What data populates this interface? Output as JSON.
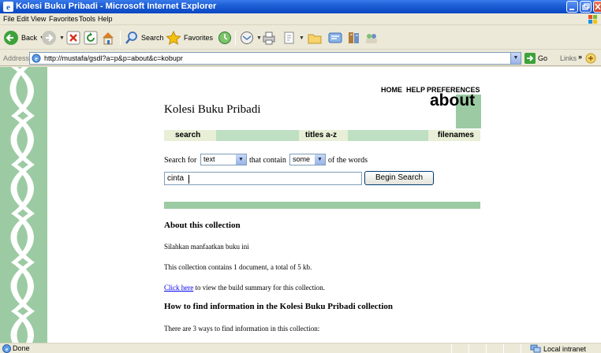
{
  "window": {
    "title": "Kolesi Buku Pribadi - Microsoft Internet Explorer"
  },
  "menu": [
    "File",
    "Edit",
    "View",
    "Favorites",
    "Tools",
    "Help"
  ],
  "toolbar": {
    "back": "Back",
    "search": "Search",
    "favorites": "Favorites"
  },
  "address": {
    "label": "Address",
    "url": "http://mustafa/gsdl?a=p&p=about&c=kobupr",
    "go": "Go",
    "links": "Links",
    "chevron": "»"
  },
  "page": {
    "nav_links": [
      "HOME",
      "HELP",
      "PREFERENCES"
    ],
    "collection_title": "Kolesi Buku Pribadi",
    "page_name": "about",
    "nav_bar": [
      "search",
      "titles a-z",
      "filenames"
    ],
    "search": {
      "search_for": "Search for",
      "field_value": "text",
      "that_contain": "that contain",
      "mode_value": "some",
      "of_the_words": "of the words",
      "query": "cinta",
      "button": "Begin Search"
    },
    "about_heading": "About this collection",
    "description": "Silahkan manfaatkan buku ini",
    "contents_line": "This collection contains 1 document, a total of 5 kb.",
    "click_here": "Click here",
    "build_summary": " to view the build summary for this collection.",
    "howto_heading": "How to find information in the Kolesi Buku Pribadi collection",
    "ways_line": "There are 3 ways to find information in this collection:"
  },
  "status": {
    "text": "Done",
    "zone": "Local intranet"
  },
  "colors": {
    "accent_green": "#9CCBA3",
    "nav_bar": "#BFDFC3",
    "title_bar": "#0B46C2"
  }
}
